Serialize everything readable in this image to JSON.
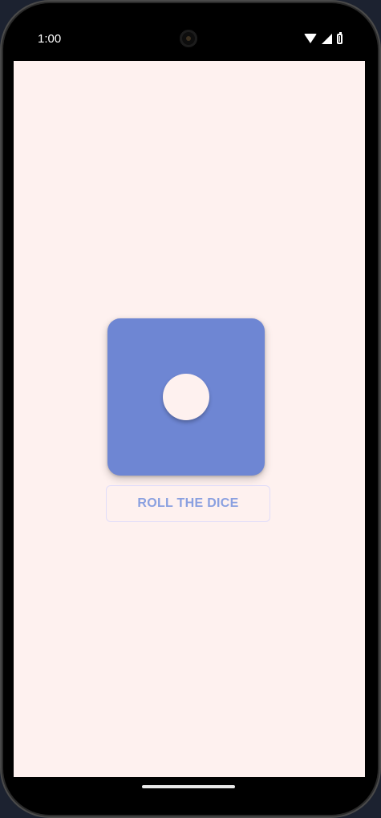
{
  "status_bar": {
    "time": "1:00",
    "icons": [
      "wifi-icon",
      "cellular-signal-icon",
      "battery-icon"
    ]
  },
  "dice": {
    "value": 1,
    "color": "#6e86d3",
    "pip_color": "#fef1ef"
  },
  "roll_button": {
    "label": "ROLL THE DICE",
    "text_color": "#8aa0e0"
  },
  "colors": {
    "screen_background": "#fef1ef"
  }
}
